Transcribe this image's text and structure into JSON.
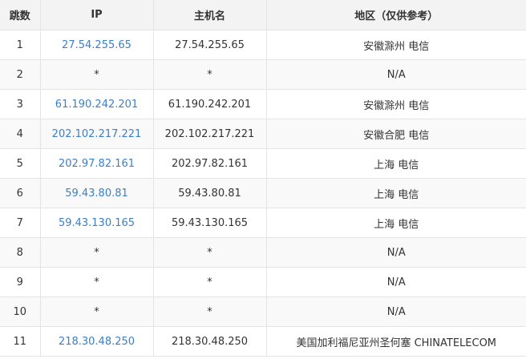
{
  "table": {
    "headers": {
      "hop": "跳数",
      "ip": "IP",
      "host": "主机名",
      "region": "地区（仅供参考）"
    },
    "rows": [
      {
        "hop": "1",
        "ip": "27.54.255.65",
        "ip_link": true,
        "host": "27.54.255.65",
        "region": "安徽滁州 电信"
      },
      {
        "hop": "2",
        "ip": "*",
        "ip_link": false,
        "host": "*",
        "region": "N/A"
      },
      {
        "hop": "3",
        "ip": "61.190.242.201",
        "ip_link": true,
        "host": "61.190.242.201",
        "region": "安徽滁州 电信"
      },
      {
        "hop": "4",
        "ip": "202.102.217.221",
        "ip_link": true,
        "host": "202.102.217.221",
        "region": "安徽合肥 电信"
      },
      {
        "hop": "5",
        "ip": "202.97.82.161",
        "ip_link": true,
        "host": "202.97.82.161",
        "region": "上海 电信"
      },
      {
        "hop": "6",
        "ip": "59.43.80.81",
        "ip_link": true,
        "host": "59.43.80.81",
        "region": "上海 电信"
      },
      {
        "hop": "7",
        "ip": "59.43.130.165",
        "ip_link": true,
        "host": "59.43.130.165",
        "region": "上海 电信"
      },
      {
        "hop": "8",
        "ip": "*",
        "ip_link": false,
        "host": "*",
        "region": "N/A"
      },
      {
        "hop": "9",
        "ip": "*",
        "ip_link": false,
        "host": "*",
        "region": "N/A"
      },
      {
        "hop": "10",
        "ip": "*",
        "ip_link": false,
        "host": "*",
        "region": "N/A"
      },
      {
        "hop": "11",
        "ip": "218.30.48.250",
        "ip_link": true,
        "host": "218.30.48.250",
        "region": "美国加利福尼亚州圣何塞 CHINATELECOM"
      }
    ]
  },
  "colors": {
    "link": "#3a7fc8",
    "header_bg": "#f3f3f3",
    "border": "#e4e4e4",
    "text": "#333333"
  }
}
